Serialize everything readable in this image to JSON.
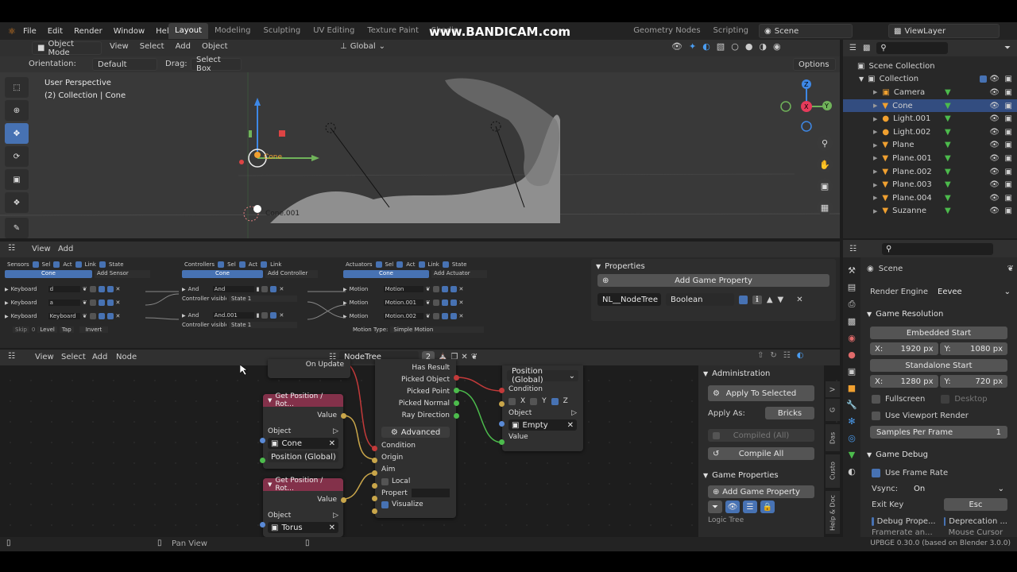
{
  "watermark": "www.BANDICAM.com",
  "menu": {
    "file": "File",
    "edit": "Edit",
    "render": "Render",
    "window": "Window",
    "help": "Help"
  },
  "workspaces": [
    "Layout",
    "Modeling",
    "Sculpting",
    "UV Editing",
    "Texture Paint",
    "Shadin",
    "Geometry Nodes",
    "Scripting"
  ],
  "scene": "Scene",
  "viewlayer": "ViewLayer",
  "viewport": {
    "mode": "Object Mode",
    "menus": [
      "View",
      "Select",
      "Add",
      "Object"
    ],
    "transform": "Global",
    "orientation_label": "Orientation:",
    "orientation_value": "Default",
    "drag_label": "Drag:",
    "drag_value": "Select Box",
    "options": "Options",
    "info_line1": "User Perspective",
    "info_line2": "(2) Collection | Cone",
    "obj_label1": "Cone",
    "obj_label2": "Cone.001"
  },
  "outliner": {
    "root": "Scene Collection",
    "collection": "Collection",
    "items": [
      "Camera",
      "Cone",
      "Light.001",
      "Light.002",
      "Plane",
      "Plane.001",
      "Plane.002",
      "Plane.003",
      "Plane.004",
      "Suzanne"
    ]
  },
  "logic": {
    "menus": [
      "View",
      "Add"
    ],
    "sensors": {
      "title": "Sensors",
      "sel": "Sel",
      "act": "Act",
      "link": "Link",
      "state": "State",
      "obj": "Cone",
      "add": "Add Sensor",
      "rows": [
        {
          "type": "Keyboard",
          "val": "d"
        },
        {
          "type": "Keyboard",
          "val": "a"
        },
        {
          "type": "Keyboard",
          "val": "Keyboard"
        }
      ],
      "extra": {
        "skip": "Skip",
        "zero": "0",
        "level": "Level",
        "tap": "Tap",
        "invert": "Invert"
      }
    },
    "controllers": {
      "title": "Controllers",
      "sel": "Sel",
      "act": "Act",
      "link": "Link",
      "obj": "Cone",
      "add": "Add Controller",
      "rows": [
        {
          "type": "And",
          "name": "And",
          "sub": "Controller visible ...",
          "state": "State 1"
        },
        {
          "type": "And",
          "name": "And.001",
          "sub": "Controller visible ...",
          "state": "State 1"
        }
      ]
    },
    "actuators": {
      "title": "Actuators",
      "sel": "Sel",
      "act": "Act",
      "link": "Link",
      "state": "State",
      "obj": "Cone",
      "add": "Add Actuator",
      "rows": [
        {
          "type": "Motion",
          "name": "Motion"
        },
        {
          "type": "Motion",
          "name": "Motion.001"
        },
        {
          "type": "Motion",
          "name": "Motion.002"
        }
      ],
      "motion_type_label": "Motion Type:",
      "motion_type": "Simple Motion"
    },
    "properties": {
      "title": "Properties",
      "add": "Add Game Property",
      "prop_name": "NL__NodeTree",
      "prop_type": "Boolean"
    }
  },
  "nodeeditor": {
    "menus": [
      "View",
      "Select",
      "Add",
      "Node"
    ],
    "tree": "NodeTree",
    "users": "2",
    "nodes": {
      "gp1": {
        "title": "Get Position / Rot...",
        "value": "Value",
        "object_label": "Object",
        "object": "Cone",
        "mode": "Position (Global)"
      },
      "gp2": {
        "title": "Get Position / Rot...",
        "value": "Value",
        "object_label": "Object",
        "object": "Torus"
      },
      "ray": {
        "on_update": "On Update",
        "has_result": "Has Result",
        "picked_object": "Picked Object",
        "picked_point": "Picked Point",
        "picked_normal": "Picked Normal",
        "ray_direction": "Ray Direction",
        "advanced": "Advanced",
        "condition": "Condition",
        "origin": "Origin",
        "aim": "Aim",
        "local": "Local",
        "property": "Propert",
        "visualize": "Visualize"
      },
      "setpos": {
        "mode": "Position (Global)",
        "condition": "Condition",
        "x": "X",
        "y": "Y",
        "z": "Z",
        "object_label": "Object",
        "object": "Empty",
        "value": "Value"
      }
    },
    "side": {
      "admin_title": "Administration",
      "apply_selected": "Apply To Selected",
      "apply_as_label": "Apply As:",
      "apply_as": "Bricks",
      "compiled": "Compiled (All)",
      "compile_all": "Compile All",
      "game_props_title": "Game Properties",
      "add_game_prop": "Add Game Property",
      "logic_tree": "Logic Tree"
    },
    "tabs": [
      "V",
      "G",
      "Das",
      "Custo",
      "Help & Doc"
    ]
  },
  "properties": {
    "scene": "Scene",
    "render_engine_label": "Render Engine",
    "render_engine": "Eevee",
    "game_resolution": "Game Resolution",
    "embedded_start": "Embedded Start",
    "x_label": "X:",
    "y_label": "Y:",
    "emb_x": "1920 px",
    "emb_y": "1080 px",
    "standalone_start": "Standalone Start",
    "sa_x": "1280 px",
    "sa_y": "720 px",
    "fullscreen": "Fullscreen",
    "desktop": "Desktop",
    "use_viewport_render": "Use Viewport Render",
    "samples_label": "Samples Per Frame",
    "samples": "1",
    "game_debug": "Game Debug",
    "use_frame_rate": "Use Frame Rate",
    "vsync_label": "Vsync:",
    "vsync": "On",
    "exit_key_label": "Exit Key",
    "exit_key": "Esc",
    "debug_props": "Debug Prope...",
    "deprecation": "Deprecation ...",
    "framerate": "Framerate an...",
    "mouse_cursor": "Mouse Cursor"
  },
  "status": {
    "pan": "Pan View",
    "version": "UPBGE 0.30.0 (based on Blender 3.0.0)"
  }
}
